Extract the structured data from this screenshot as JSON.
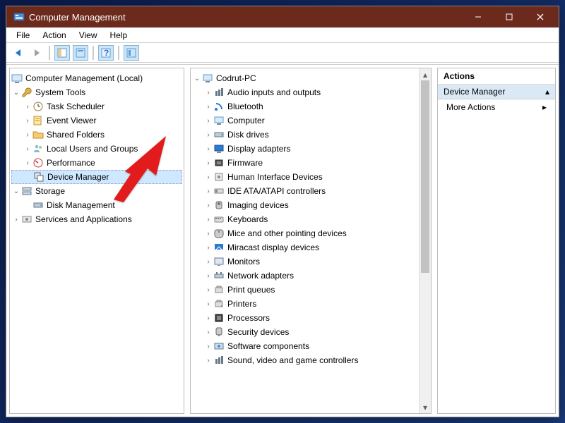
{
  "window": {
    "title": "Computer Management"
  },
  "menu": {
    "file": "File",
    "action": "Action",
    "view": "View",
    "help": "Help"
  },
  "left": {
    "root": "Computer Management (Local)",
    "system_tools": "System Tools",
    "task_scheduler": "Task Scheduler",
    "event_viewer": "Event Viewer",
    "shared_folders": "Shared Folders",
    "local_users": "Local Users and Groups",
    "performance": "Performance",
    "device_manager": "Device Manager",
    "storage": "Storage",
    "disk_management": "Disk Management",
    "services_apps": "Services and Applications"
  },
  "mid": {
    "pc": "Codrut-PC",
    "items": [
      "Audio inputs and outputs",
      "Bluetooth",
      "Computer",
      "Disk drives",
      "Display adapters",
      "Firmware",
      "Human Interface Devices",
      "IDE ATA/ATAPI controllers",
      "Imaging devices",
      "Keyboards",
      "Mice and other pointing devices",
      "Miracast display devices",
      "Monitors",
      "Network adapters",
      "Print queues",
      "Printers",
      "Processors",
      "Security devices",
      "Software components",
      "Sound, video and game controllers"
    ]
  },
  "right": {
    "header": "Actions",
    "sub": "Device Manager",
    "more": "More Actions"
  }
}
